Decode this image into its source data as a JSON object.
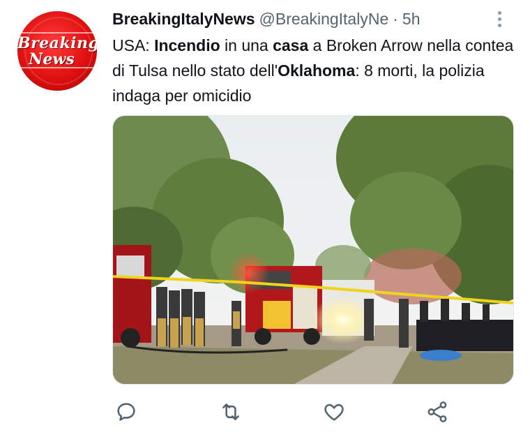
{
  "tweet": {
    "author_name": "BreakingItalyNews",
    "author_handle": "@BreakingItalyNe",
    "separator": "·",
    "time": "5h",
    "avatar_text_line1": "Breaking",
    "avatar_text_line2": "News",
    "text_parts": {
      "p1": "USA: ",
      "p2": "Incendio",
      "p3": " in una ",
      "p4": "casa",
      "p5": " a Broken Arrow nella contea di Tulsa nello stato dell'",
      "p6": "Oklahoma",
      "p7": ": 8 morti, la polizia indaga per omicidio"
    }
  },
  "actions": {
    "reply_icon": "reply-icon",
    "retweet_icon": "retweet-icon",
    "like_icon": "heart-icon",
    "share_icon": "share-icon",
    "icon_color": "#536471"
  },
  "colors": {
    "text": "#0f1419",
    "secondary": "#536471",
    "avatar_red": "#e01010"
  }
}
